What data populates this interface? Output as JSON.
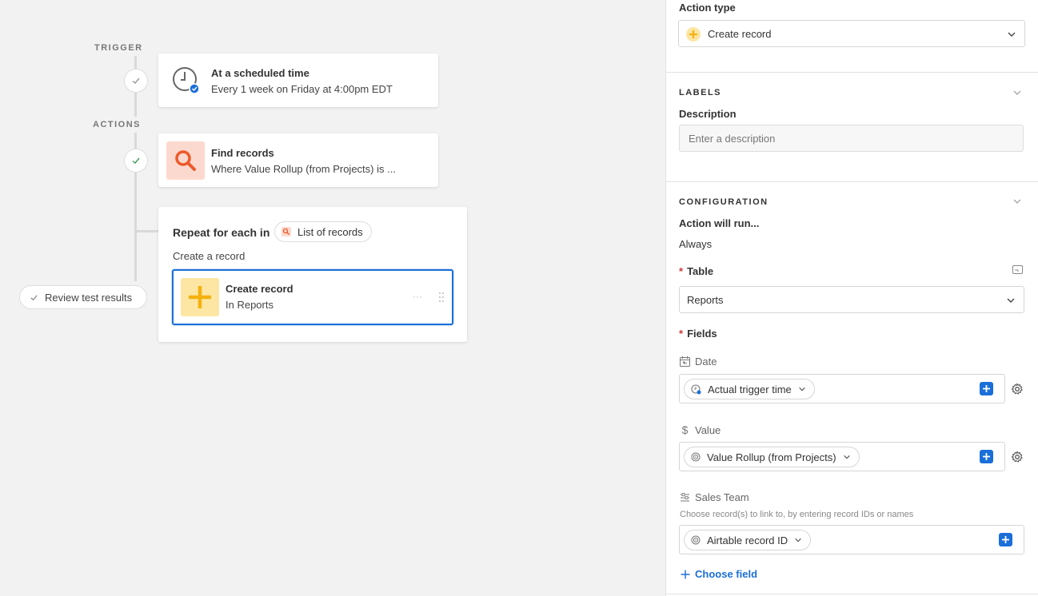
{
  "canvas": {
    "trigger_label": "TRIGGER",
    "actions_label": "ACTIONS",
    "trigger_card": {
      "title": "At a scheduled time",
      "subtitle": "Every 1 week on Friday at 4:00pm EDT"
    },
    "find_card": {
      "title": "Find records",
      "subtitle": "Where Value Rollup (from Projects) is ..."
    },
    "repeat_card": {
      "title": "Repeat for each in",
      "token": "List of records",
      "description": "Create a record",
      "inner": {
        "title": "Create record",
        "subtitle": "In Reports",
        "more": "···"
      }
    },
    "review_button": "Review test results"
  },
  "panel": {
    "action_type_label": "Action type",
    "action_type_value": "Create record",
    "labels_header": "LABELS",
    "description_label": "Description",
    "description_placeholder": "Enter a description",
    "configuration_header": "CONFIGURATION",
    "action_will_run_label": "Action will run...",
    "action_will_run_value": "Always",
    "table_label": "Table",
    "table_value": "Reports",
    "fields_label": "Fields",
    "date_field": {
      "label": "Date",
      "token": "Actual trigger time"
    },
    "value_field": {
      "label": "Value",
      "token": "Value Rollup (from Projects)"
    },
    "sales_team_field": {
      "label": "Sales Team",
      "hint": "Choose record(s) to link to, by entering record IDs or names",
      "token": "Airtable record ID"
    },
    "choose_field": "Choose field",
    "required_mark": "*"
  },
  "colors": {
    "accent_blue": "#1b6fd8",
    "find_bg": "#fcd9cf",
    "find_icon": "#ec5a2b",
    "create_bg": "#fde6a3",
    "create_icon": "#f5b10f"
  }
}
